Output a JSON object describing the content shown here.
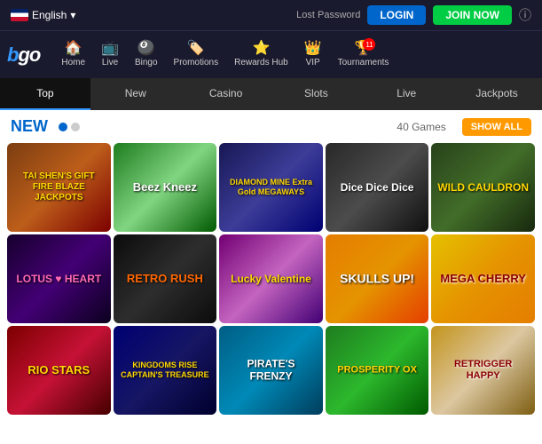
{
  "topbar": {
    "language": "English",
    "lost_password": "Lost Password",
    "login_label": "LOGIN",
    "join_label": "JOIN NOW"
  },
  "logo": "bgo",
  "nav": {
    "items": [
      {
        "id": "home",
        "label": "Home",
        "icon": "🏠"
      },
      {
        "id": "live",
        "label": "Live",
        "icon": "📺"
      },
      {
        "id": "bingo",
        "label": "Bingo",
        "icon": "🎱"
      },
      {
        "id": "promotions",
        "label": "Promotions",
        "icon": "🏷️"
      },
      {
        "id": "rewards",
        "label": "Rewards Hub",
        "icon": "⭐"
      },
      {
        "id": "vip",
        "label": "VIP",
        "icon": "👑"
      },
      {
        "id": "tournaments",
        "label": "Tournaments",
        "icon": "🏆",
        "badge": "11"
      }
    ]
  },
  "categories": [
    {
      "id": "top",
      "label": "Top",
      "active": true
    },
    {
      "id": "new",
      "label": "New",
      "active": false
    },
    {
      "id": "casino",
      "label": "Casino",
      "active": false
    },
    {
      "id": "slots",
      "label": "Slots",
      "active": false
    },
    {
      "id": "live",
      "label": "Live",
      "active": false
    },
    {
      "id": "jackpots",
      "label": "Jackpots",
      "active": false
    }
  ],
  "section": {
    "title": "NEW",
    "game_count": "40 Games",
    "show_all": "SHOW ALL",
    "dots": [
      true,
      false
    ]
  },
  "games": [
    {
      "id": "tai-shen",
      "title": "TAI SHEN'S GIFT FIRE BLAZE JACKPOTS",
      "class": "game-tai-shen"
    },
    {
      "id": "beez-kneez",
      "title": "Beez Kneez",
      "class": "game-beez"
    },
    {
      "id": "diamond-mine",
      "title": "DIAMOND MINE Extra Gold MEGAWAYS",
      "class": "game-diamond"
    },
    {
      "id": "dice-dice-dice",
      "title": "Dice Dice Dice",
      "class": "game-dice"
    },
    {
      "id": "wild-cauldron",
      "title": "WILD CAULDRON",
      "class": "game-wild"
    },
    {
      "id": "lotus-heart",
      "title": "LOTUS ♥ HEART",
      "class": "game-lotus"
    },
    {
      "id": "retro-rush",
      "title": "RETRO RUSH",
      "class": "game-retro"
    },
    {
      "id": "lucky-valentine",
      "title": "Lucky Valentine",
      "class": "game-lucky"
    },
    {
      "id": "skulls-up",
      "title": "SKULLS UP!",
      "class": "game-skulls"
    },
    {
      "id": "mega-cherry",
      "title": "MEGA CHERRY",
      "class": "game-mega"
    },
    {
      "id": "rio-stars",
      "title": "RIO STARS",
      "class": "game-rio"
    },
    {
      "id": "captains-treasure",
      "title": "KINGDOMS RISE CAPTAIN'S TREASURE",
      "class": "game-captain"
    },
    {
      "id": "pirates-frenzy",
      "title": "PIRATE'S FRENZY",
      "class": "game-pirates"
    },
    {
      "id": "prosperity-ox",
      "title": "PROSPERITY OX",
      "class": "game-prosperity"
    },
    {
      "id": "retrigger-happy",
      "title": "RETRIGGER HAPPY",
      "class": "game-retrigger"
    }
  ]
}
